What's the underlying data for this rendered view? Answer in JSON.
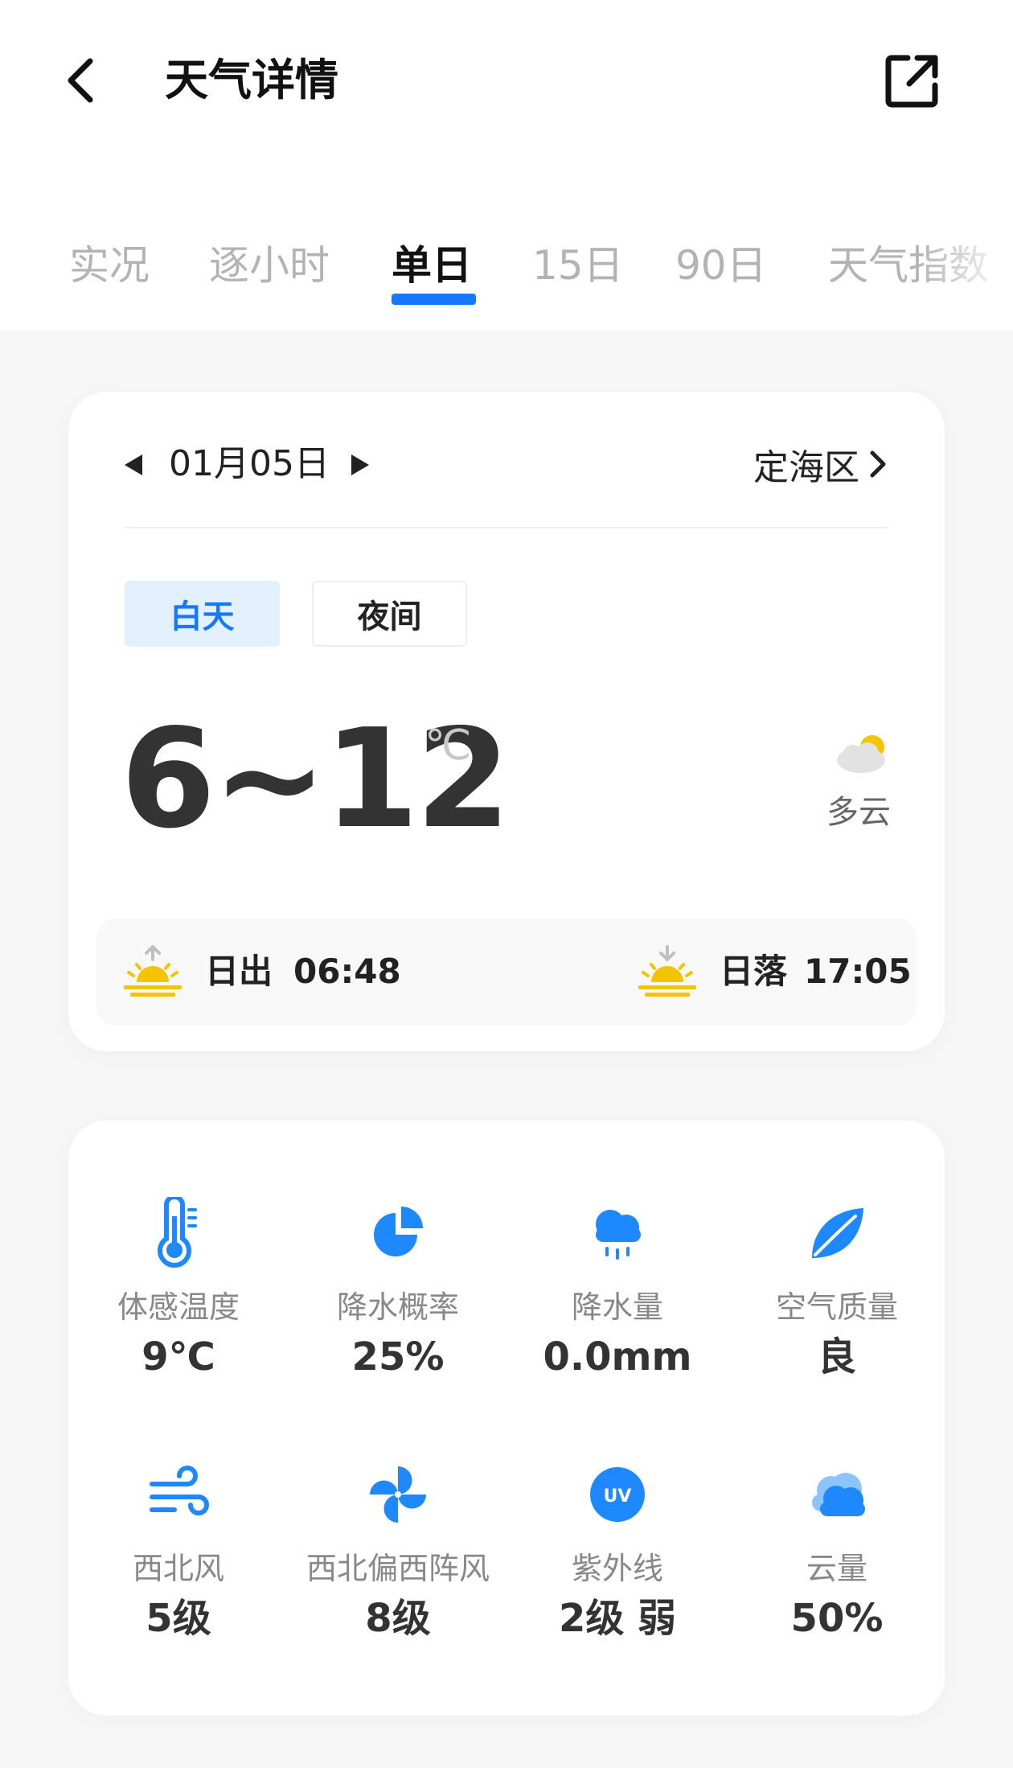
{
  "header": {
    "title": "天气详情",
    "back_icon": "chevron-left-icon",
    "share_icon": "external-link-icon"
  },
  "tabs": [
    {
      "label": "实况",
      "active": false
    },
    {
      "label": "逐小时",
      "active": false
    },
    {
      "label": "单日",
      "active": true
    },
    {
      "label": "15日",
      "active": false
    },
    {
      "label": "90日",
      "active": false
    },
    {
      "label": "天气指数",
      "active": false
    }
  ],
  "day_card": {
    "date": "01月05日",
    "location": "定海区",
    "toggle": {
      "day_label": "白天",
      "night_label": "夜间",
      "selected": "白天"
    },
    "temperature": "6~12",
    "temperature_unit": "℃",
    "condition": "多云",
    "sunrise": {
      "label": "日出",
      "time": "06:48"
    },
    "sunset": {
      "label": "日落",
      "time": "17:05"
    }
  },
  "metrics": [
    {
      "icon": "thermometer-icon",
      "label": "体感温度",
      "value": "9℃"
    },
    {
      "icon": "pie-chart-icon",
      "label": "降水概率",
      "value": "25%"
    },
    {
      "icon": "rain-cloud-icon",
      "label": "降水量",
      "value": "0.0mm"
    },
    {
      "icon": "leaf-icon",
      "label": "空气质量",
      "value": "良"
    },
    {
      "icon": "wind-icon",
      "label": "西北风",
      "value": "5级"
    },
    {
      "icon": "pinwheel-icon",
      "label": "西北偏西阵风",
      "value": "8级"
    },
    {
      "icon": "uv-icon",
      "label": "紫外线",
      "value": "2级 弱"
    },
    {
      "icon": "cloud-icon",
      "label": "云量",
      "value": "50%"
    }
  ],
  "colors": {
    "accent": "#1677ff",
    "accent_light": "#e3f1ff",
    "sun_yellow": "#f5c400",
    "icon_blue": "#1e88ff"
  }
}
